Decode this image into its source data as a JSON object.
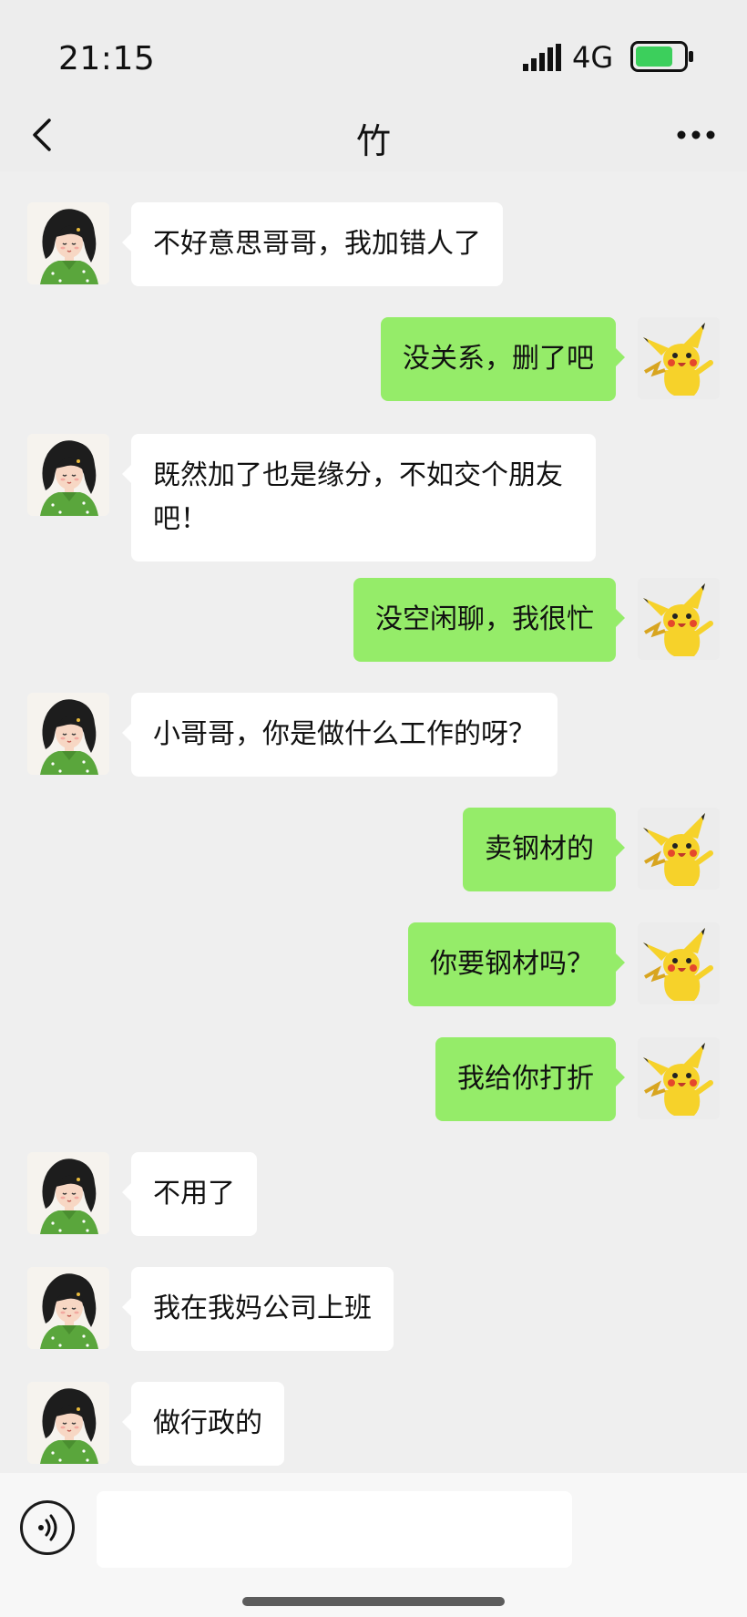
{
  "status_bar": {
    "time": "21:15",
    "network": "4G",
    "battery_level": 0.8,
    "battery_color": "#3ccf5c"
  },
  "header": {
    "title": "竹",
    "back_icon": "chevron-left-icon",
    "more_icon": "more-dots-icon"
  },
  "colors": {
    "background": "#ededed",
    "outgoing_bubble": "#95ec69",
    "incoming_bubble": "#ffffff"
  },
  "messages": [
    {
      "side": "left",
      "avatar": "girl-avatar",
      "text": "不好意思哥哥，我加错人了"
    },
    {
      "side": "right",
      "avatar": "pikachu-avatar",
      "text": "没关系，删了吧"
    },
    {
      "side": "left",
      "avatar": "girl-avatar",
      "text": "既然加了也是缘分，不如交个朋友吧！"
    },
    {
      "side": "right",
      "avatar": "pikachu-avatar",
      "text": "没空闲聊，我很忙"
    },
    {
      "side": "left",
      "avatar": "girl-avatar",
      "text": "小哥哥，你是做什么工作的呀？"
    },
    {
      "side": "right",
      "avatar": "pikachu-avatar",
      "text": "卖钢材的"
    },
    {
      "side": "right",
      "avatar": "pikachu-avatar",
      "text": "你要钢材吗？"
    },
    {
      "side": "right",
      "avatar": "pikachu-avatar",
      "text": "我给你打折"
    },
    {
      "side": "left",
      "avatar": "girl-avatar",
      "text": "不用了"
    },
    {
      "side": "left",
      "avatar": "girl-avatar",
      "text": "我在我妈公司上班"
    },
    {
      "side": "left",
      "avatar": "girl-avatar",
      "text": "做行政的"
    }
  ],
  "input_bar": {
    "voice_icon": "voice-icon",
    "input_value": ""
  }
}
